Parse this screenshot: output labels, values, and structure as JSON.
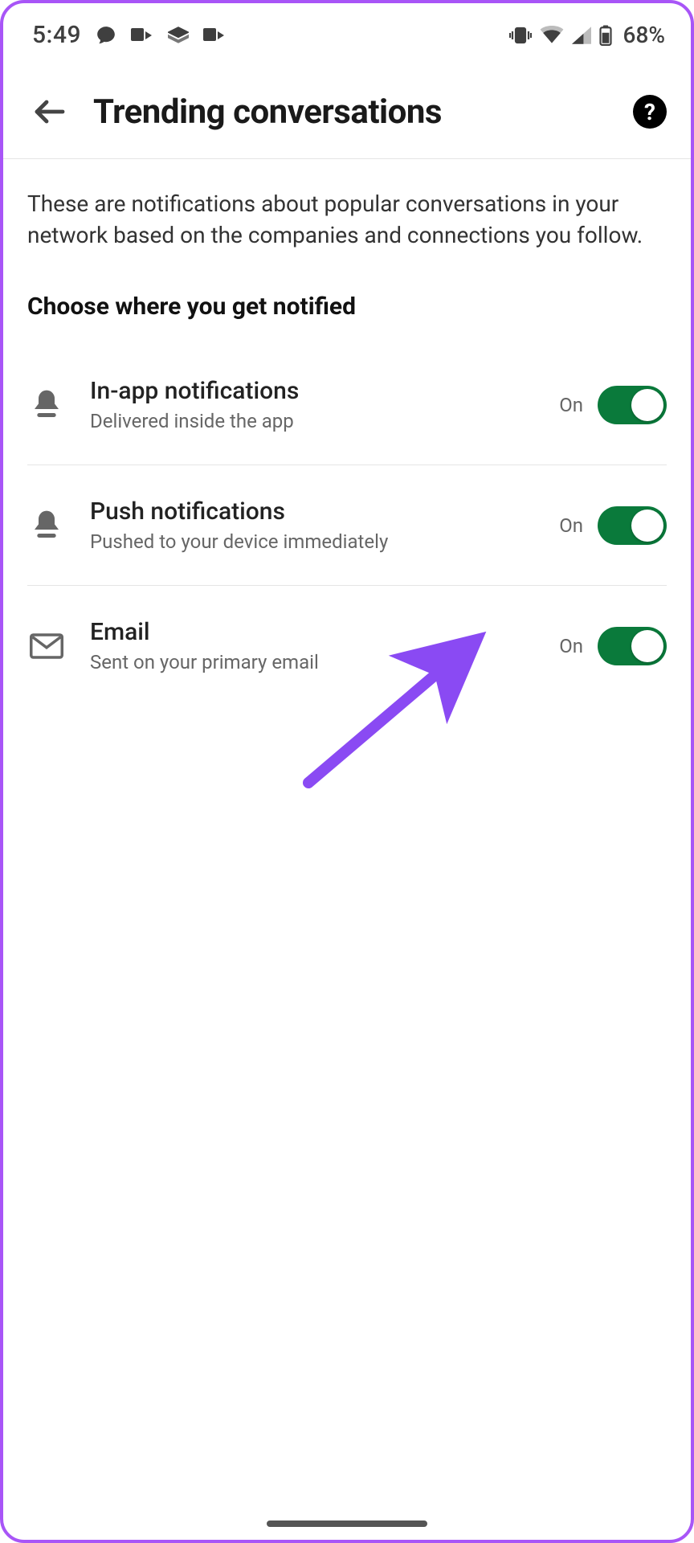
{
  "status": {
    "time": "5:49",
    "battery": "68%"
  },
  "header": {
    "title": "Trending conversations"
  },
  "description": "These are notifications about popular conversations in your network based on the companies and connections you follow.",
  "section_title": "Choose where you get notified",
  "options": [
    {
      "title": "In-app notifications",
      "subtitle": "Delivered inside the app",
      "state": "On",
      "icon": "bell"
    },
    {
      "title": "Push notifications",
      "subtitle": "Pushed to your device immediately",
      "state": "On",
      "icon": "bell"
    },
    {
      "title": "Email",
      "subtitle": "Sent on your primary email",
      "state": "On",
      "icon": "mail"
    }
  ]
}
